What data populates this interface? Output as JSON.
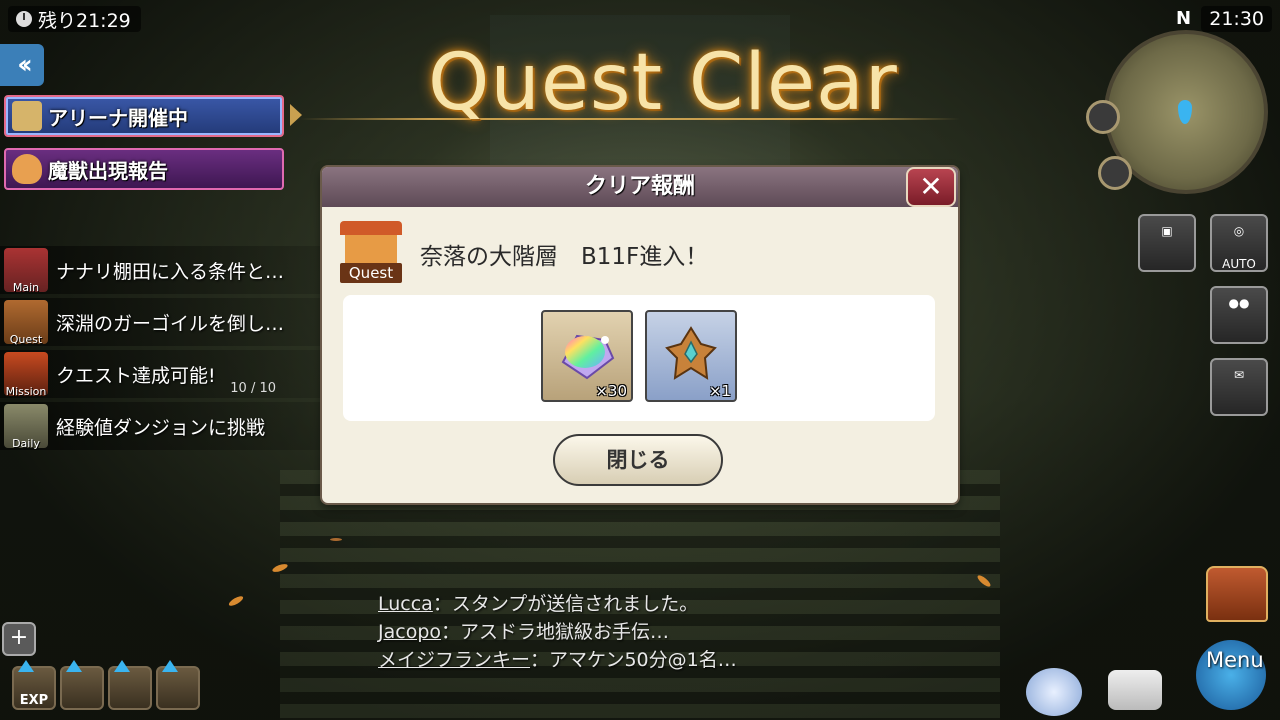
{
  "hud": {
    "remaining_time": "残り21:29",
    "clock": "21:30",
    "compass_north": "N"
  },
  "banners": {
    "arena": "アリーナ開催中",
    "beast": "魔獣出現報告"
  },
  "quests": [
    {
      "tag": "Main",
      "text": "ナナリ棚田に入る条件と…",
      "count": ""
    },
    {
      "tag": "Quest",
      "text": "深淵のガーゴイルを倒し…",
      "count": ""
    },
    {
      "tag": "Mission",
      "text": "クエスト達成可能!",
      "count": "10 / 10"
    },
    {
      "tag": "Daily",
      "text": "経験値ダンジョンに挑戦",
      "count": ""
    }
  ],
  "title": "Quest Clear",
  "dialog": {
    "header": "クリア報酬",
    "quest_badge": "Quest",
    "reward_text": "奈落の大階層　B11F進入！",
    "items": [
      {
        "icon": "rainbow-gem-icon",
        "qty": "×30"
      },
      {
        "icon": "bronze-crest-icon",
        "qty": "×1"
      }
    ],
    "close_label": "閉じる"
  },
  "side_buttons": {
    "auto_label": "AUTO"
  },
  "chat": [
    {
      "name": "Lucca",
      "msg": "：スタンプが送信されました。"
    },
    {
      "name": "Jacopo",
      "msg": "：アスドラ地獄級お手伝…"
    },
    {
      "name": "メイジフランキー",
      "msg": "：アマケン50分@1名…"
    }
  ],
  "bottom": {
    "exp_label": "EXP",
    "menu_label": "Menu"
  },
  "colors": {
    "title_glow": "#d88a20",
    "dialog_header": "#6e5a66",
    "close_x": "#9a2c38",
    "dialog_bg": "#f3efe1"
  }
}
